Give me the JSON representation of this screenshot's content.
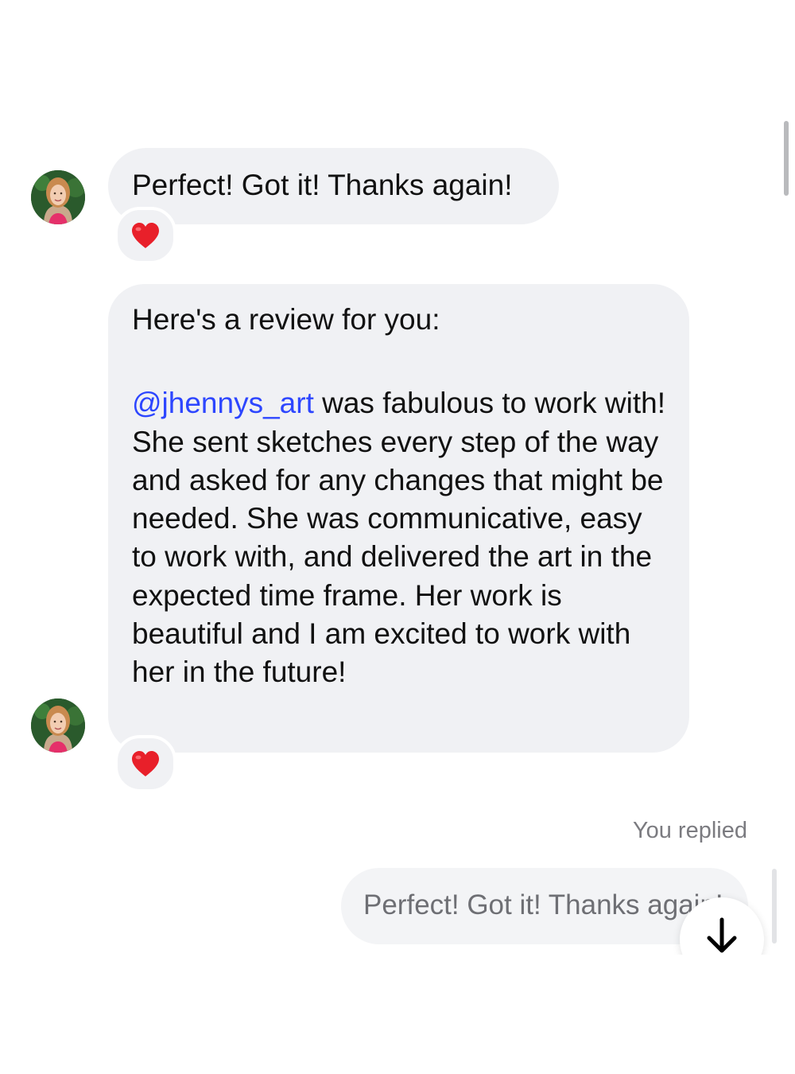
{
  "messages": [
    {
      "text": "Perfect! Got it! Thanks again!",
      "reaction": "red-heart-icon"
    },
    {
      "intro": "Here's a review for you:",
      "mention": "@jhennys_art",
      "body": " was fabulous to work with! She sent sketches every step of the way and asked for any changes that might be needed. She was communicative, easy to work with, and delivered the art in the expected time frame. Her work is beautiful and I am excited to work with her in the future!",
      "reaction": "red-heart-icon"
    }
  ],
  "reply": {
    "label": "You replied",
    "quoted_text": "Perfect! Got it! Thanks again!"
  },
  "controls": {
    "scroll_down_icon": "arrow-down-icon"
  },
  "colors": {
    "bubble_bg": "#f0f1f4",
    "mention": "#2d46ff",
    "heart": "#e8202a",
    "muted_text": "#7b7b80"
  }
}
